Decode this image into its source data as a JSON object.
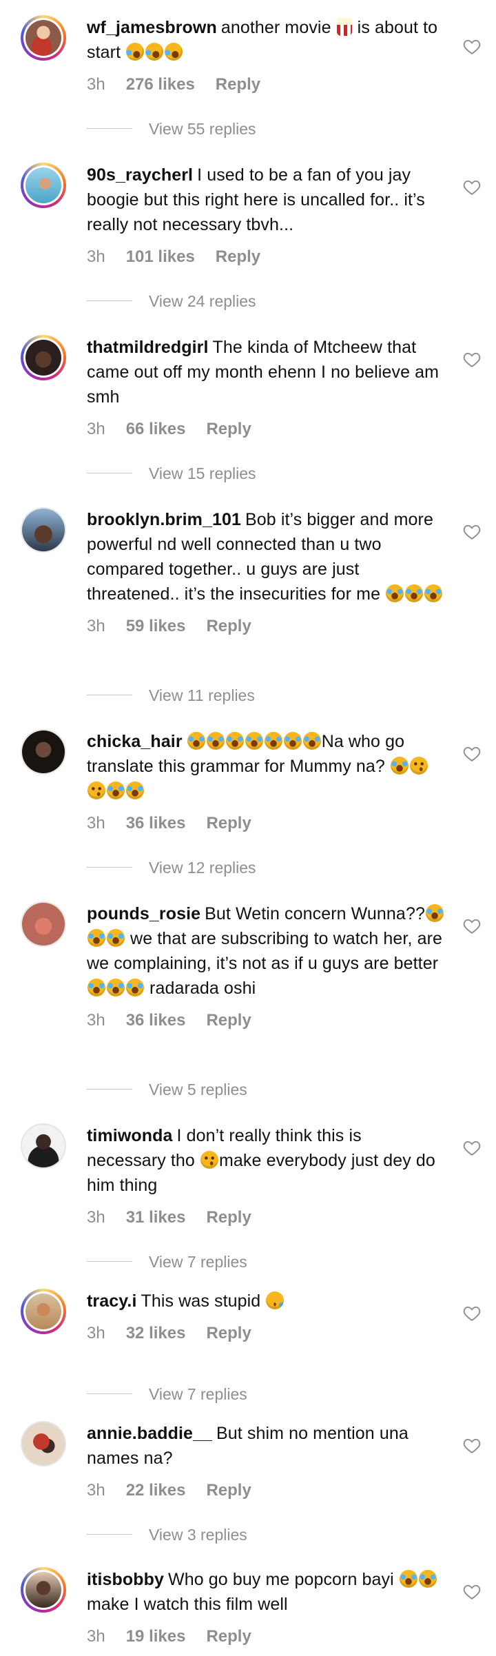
{
  "comments": [
    {
      "username": "wf_jamesbrown",
      "text_parts": [
        {
          "t": "another movie "
        },
        {
          "e": "popcorn-emoji"
        },
        {
          "t": " is about to start "
        },
        {
          "e": "rofl-emoji"
        },
        {
          "e": "rofl-emoji"
        },
        {
          "e": "rofl-emoji"
        }
      ],
      "time": "3h",
      "likes": "276 likes",
      "reply": "Reply",
      "view_replies": "View 55 replies",
      "avatar_color": "#8a5a4a"
    },
    {
      "username": "90s_raycherl",
      "text_parts": [
        {
          "t": "I used to be a fan of you jay boogie but this right here is uncalled for.. it’s really not necessary tbvh..."
        }
      ],
      "time": "3h",
      "likes": "101 likes",
      "reply": "Reply",
      "view_replies": "View 24 replies",
      "avatar_color": "#4ea6c9"
    },
    {
      "username": "thatmildredgirl",
      "text_parts": [
        {
          "t": "The kinda of Mtcheew that came out off my month ehenn I no believe am smh"
        }
      ],
      "time": "3h",
      "likes": "66 likes",
      "reply": "Reply",
      "view_replies": "View 15 replies",
      "avatar_color": "#3a2a2a"
    },
    {
      "username": "brooklyn.brim_101",
      "text_parts": [
        {
          "t": "Bob it’s bigger and more powerful nd well connected than u two compared together.. u guys are just threatened.. it’s the insecurities for me "
        },
        {
          "e": "joy-emoji"
        },
        {
          "e": "joy-emoji"
        },
        {
          "e": "joy-emoji"
        }
      ],
      "time": "3h",
      "likes": "59 likes",
      "reply": "Reply",
      "view_replies": "View 11 replies",
      "avatar_color": "#2e3a4a"
    },
    {
      "username": "chicka_hair",
      "text_parts": [
        {
          "e": "joy-emoji"
        },
        {
          "e": "joy-emoji"
        },
        {
          "e": "joy-emoji"
        },
        {
          "e": "joy-emoji"
        },
        {
          "e": "joy-emoji"
        },
        {
          "e": "joy-emoji"
        },
        {
          "e": "joy-emoji"
        },
        {
          "t": "Na who go translate this grammar for Mummy na? "
        },
        {
          "e": "joy-emoji"
        },
        {
          "e": "smirk-emoji"
        },
        {
          "e": "smirk-emoji"
        },
        {
          "e": "joy-emoji"
        },
        {
          "e": "joy-emoji"
        }
      ],
      "time": "3h",
      "likes": "36 likes",
      "reply": "Reply",
      "view_replies": "View 12 replies",
      "avatar_color": "#2a1e1a"
    },
    {
      "username": "pounds_rosie",
      "text_parts": [
        {
          "t": "But Wetin concern Wunna??"
        },
        {
          "e": "joy-emoji"
        },
        {
          "e": "joy-emoji"
        },
        {
          "e": "joy-emoji"
        },
        {
          "t": " we that are subscribing to watch her, are we complaining, it’s not as if u guys are better"
        },
        {
          "e": "joy-emoji"
        },
        {
          "e": "joy-emoji"
        },
        {
          "e": "joy-emoji"
        },
        {
          "t": " radarada oshi"
        }
      ],
      "time": "3h",
      "likes": "36 likes",
      "reply": "Reply",
      "view_replies": "View 5 replies",
      "avatar_color": "#b9695a"
    },
    {
      "username": "timiwonda",
      "text_parts": [
        {
          "t": "I don’t really think this is necessary tho "
        },
        {
          "e": "smirk-emoji"
        },
        {
          "t": "make everybody just dey do him thing"
        }
      ],
      "time": "3h",
      "likes": "31 likes",
      "reply": "Reply",
      "view_replies": "View 7 replies",
      "avatar_color": "#1d1d1d"
    },
    {
      "username": "tracy.i",
      "text_parts": [
        {
          "t": "This was stupid "
        },
        {
          "e": "sleepy-emoji"
        }
      ],
      "time": "3h",
      "likes": "32 likes",
      "reply": "Reply",
      "view_replies": "View 7 replies",
      "avatar_color": "#b98a5a"
    },
    {
      "username": "annie.baddie__",
      "text_parts": [
        {
          "t": "But shim  no mention una names na?"
        }
      ],
      "time": "3h",
      "likes": "22 likes",
      "reply": "Reply",
      "view_replies": "View 3 replies",
      "avatar_color": "#8a2a2a"
    },
    {
      "username": "itisbobby",
      "text_parts": [
        {
          "t": "Who go buy me popcorn bayi "
        },
        {
          "e": "joy-emoji"
        },
        {
          "e": "joy-emoji"
        },
        {
          "t": " make I watch this film well"
        }
      ],
      "time": "3h",
      "likes": "19 likes",
      "reply": "Reply",
      "view_replies": "",
      "avatar_color": "#3a2a22"
    }
  ]
}
